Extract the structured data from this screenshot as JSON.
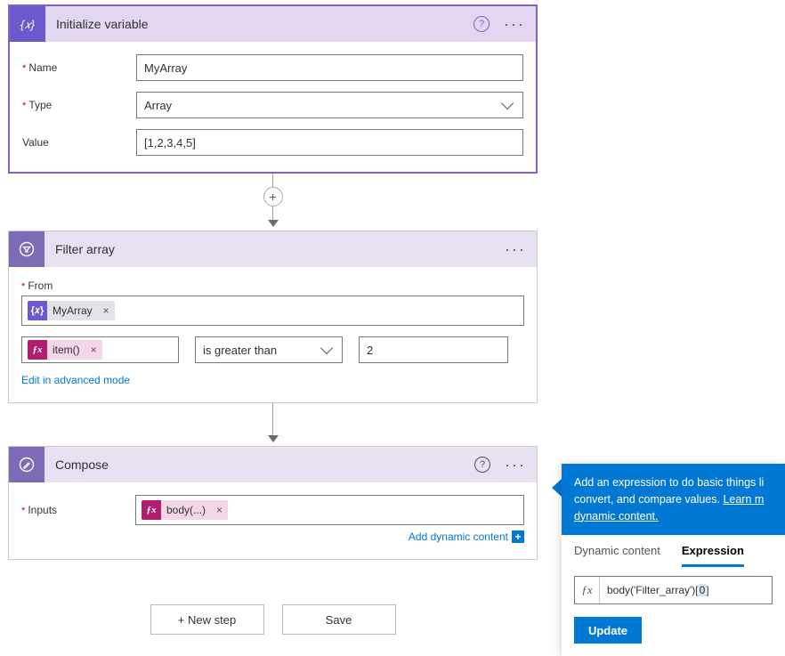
{
  "init": {
    "title": "Initialize variable",
    "labels": {
      "name": "Name",
      "type": "Type",
      "value": "Value"
    },
    "values": {
      "name": "MyArray",
      "type": "Array",
      "value": "[1,2,3,4,5]"
    }
  },
  "filter": {
    "title": "Filter array",
    "labels": {
      "from": "From"
    },
    "tokens": {
      "from_var": "MyArray",
      "item_fx": "item()"
    },
    "operator": "is greater than",
    "compare_value": "2",
    "advanced_link": "Edit in advanced mode"
  },
  "compose": {
    "title": "Compose",
    "labels": {
      "inputs": "Inputs"
    },
    "tokens": {
      "body_fx": "body(...)"
    },
    "dynamic_link": "Add dynamic content"
  },
  "actions": {
    "new_step": "+ New step",
    "save": "Save"
  },
  "popup": {
    "desc_prefix": "Add an expression to do basic things li",
    "desc_line2_prefix": "convert, and compare values. ",
    "learn_more_partial": "Learn m",
    "learn_more_line2": "dynamic content.",
    "tabs": {
      "dynamic": "Dynamic content",
      "expression": "Expression"
    },
    "expression_pre": "body('Filter_array')[",
    "expression_sel": "0",
    "expression_post": "]",
    "update": "Update"
  }
}
